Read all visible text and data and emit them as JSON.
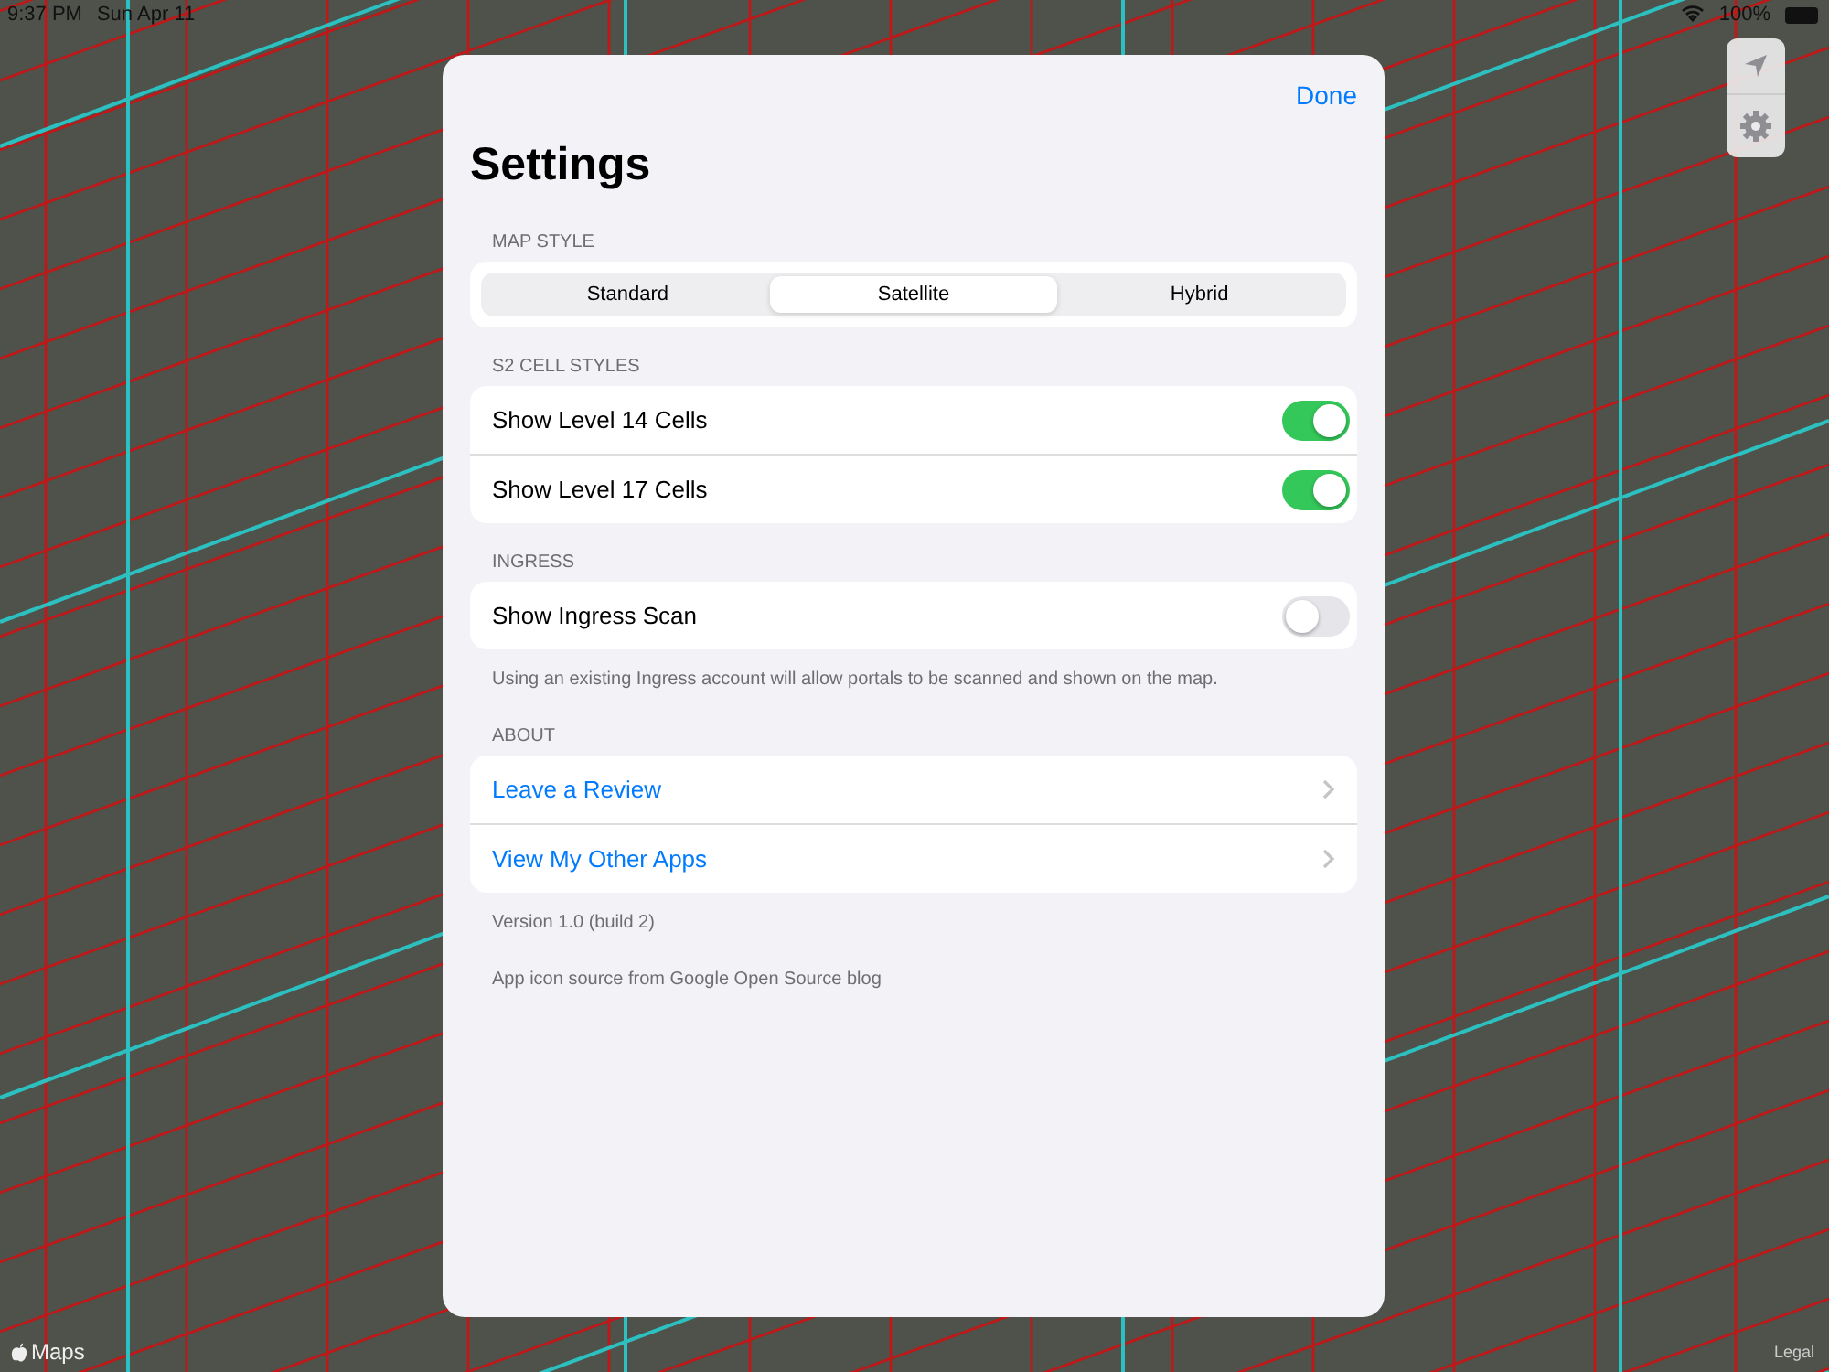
{
  "status_bar": {
    "time": "9:37 PM",
    "date": "Sun Apr 11",
    "battery": "100%"
  },
  "map": {
    "attribution": "Maps",
    "legal": "Legal"
  },
  "settings": {
    "done": "Done",
    "title": "Settings",
    "sections": [
      {
        "kind": "segmented",
        "header": "MAP STYLE",
        "segments": [
          {
            "label": "Standard",
            "selected": false
          },
          {
            "label": "Satellite",
            "selected": true
          },
          {
            "label": "Hybrid",
            "selected": false
          }
        ]
      },
      {
        "kind": "toggles",
        "header": "S2 CELL STYLES",
        "rows": [
          {
            "label": "Show Level 14 Cells",
            "on": true
          },
          {
            "label": "Show Level 17 Cells",
            "on": true
          }
        ]
      },
      {
        "kind": "toggles",
        "header": "INGRESS",
        "rows": [
          {
            "label": "Show Ingress Scan",
            "on": false
          }
        ],
        "footers": [
          "Using an existing Ingress account will allow portals to be scanned and shown on the map."
        ]
      },
      {
        "kind": "links",
        "header": "ABOUT",
        "rows": [
          {
            "label": "Leave a Review"
          },
          {
            "label": "View My Other Apps"
          }
        ],
        "footers": [
          "Version 1.0 (build 2)",
          "App icon source from Google Open Source blog"
        ]
      }
    ]
  }
}
